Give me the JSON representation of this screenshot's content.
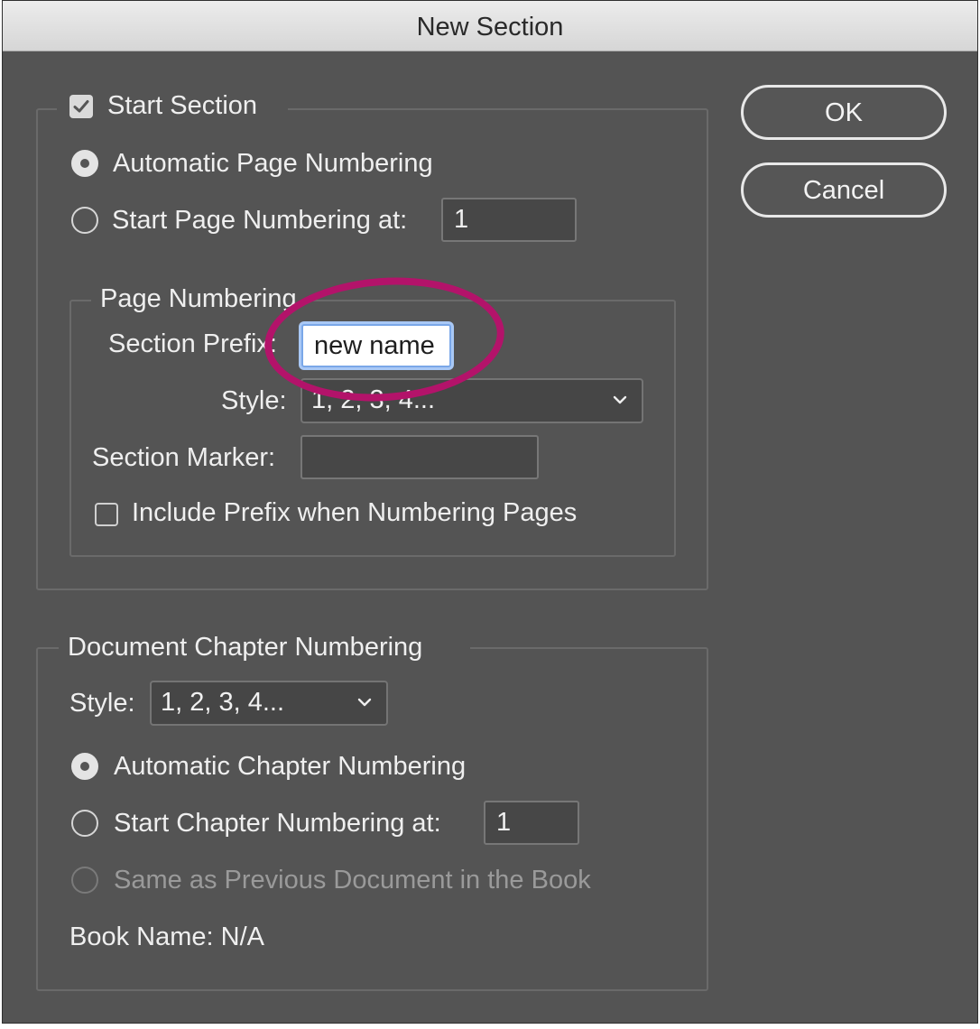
{
  "window": {
    "title": "New Section"
  },
  "buttons": {
    "ok": "OK",
    "cancel": "Cancel"
  },
  "start_section": {
    "label": "Start Section",
    "checked": true,
    "automatic_page_numbering": "Automatic Page Numbering",
    "start_page_numbering_at": "Start Page Numbering at:",
    "start_page_value": "1",
    "page_numbering": {
      "legend": "Page Numbering",
      "section_prefix_label": "Section Prefix:",
      "section_prefix_value": "new name",
      "style_label": "Style:",
      "style_value": "1, 2, 3, 4...",
      "section_marker_label": "Section Marker:",
      "section_marker_value": "",
      "include_prefix_label": "Include Prefix when Numbering Pages"
    }
  },
  "document_chapter_numbering": {
    "legend": "Document Chapter Numbering",
    "style_label": "Style:",
    "style_value": "1, 2, 3, 4...",
    "automatic_chapter_numbering": "Automatic Chapter Numbering",
    "start_chapter_numbering_at": "Start Chapter Numbering at:",
    "start_chapter_value": "1",
    "same_as_previous": "Same as Previous Document in the Book",
    "book_name": "Book Name: N/A"
  },
  "colors": {
    "dialog_bg": "#545454",
    "annotation": "#b3136a"
  }
}
